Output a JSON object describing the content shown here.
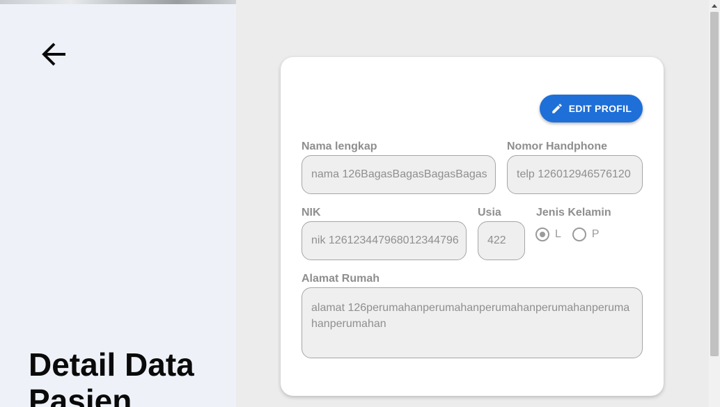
{
  "page": {
    "title": "Detail Data Pasien"
  },
  "card": {
    "edit_button_label": "EDIT PROFIL",
    "fields": {
      "nama": {
        "label": "Nama lengkap",
        "value": "nama 126BagasBagasBagasBagas"
      },
      "telp": {
        "label": "Nomor Handphone",
        "value": "telp 126012946576120"
      },
      "nik": {
        "label": "NIK",
        "value": "nik 126123447968012344796"
      },
      "usia": {
        "label": "Usia",
        "value": "422"
      },
      "gender": {
        "label": "Jenis Kelamin",
        "options": [
          "L",
          "P"
        ],
        "selected": "L"
      },
      "alamat": {
        "label": "Alamat Rumah",
        "value": "alamat 126perumahanperumahanperumahanperumahanperumahanperumahan"
      }
    }
  },
  "icons": {
    "back": "arrow-left-icon",
    "edit": "pencil-icon"
  },
  "colors": {
    "accent": "#1e6fd8",
    "left_panel_bg": "#eef2f8",
    "right_panel_bg": "#ececec"
  }
}
